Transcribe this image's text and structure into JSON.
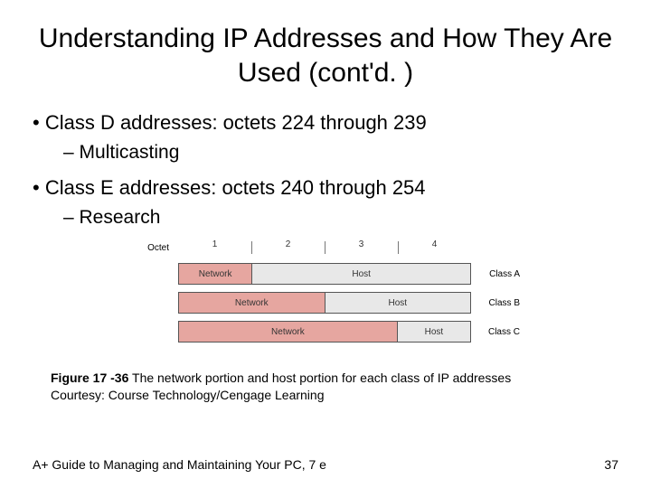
{
  "title": "Understanding IP Addresses and How They Are Used (cont'd. )",
  "bullets": {
    "b1a": "Class D addresses: octets 224 through 239",
    "b2a": "Multicasting",
    "b1b": "Class E addresses: octets 240 through 254",
    "b2b": "Research"
  },
  "figure": {
    "octet_label": "Octet",
    "oct1": "1",
    "oct2": "2",
    "oct3": "3",
    "oct4": "4",
    "network": "Network",
    "host": "Host",
    "classA": "Class A",
    "classB": "Class B",
    "classC": "Class C"
  },
  "caption": {
    "label": "Figure 17 -36",
    "text": " The network portion and host portion for each class of IP addresses",
    "credit": "Courtesy: Course Technology/Cengage Learning"
  },
  "footer": {
    "left": "A+ Guide to Managing and Maintaining Your PC, 7 e",
    "right": "37"
  }
}
